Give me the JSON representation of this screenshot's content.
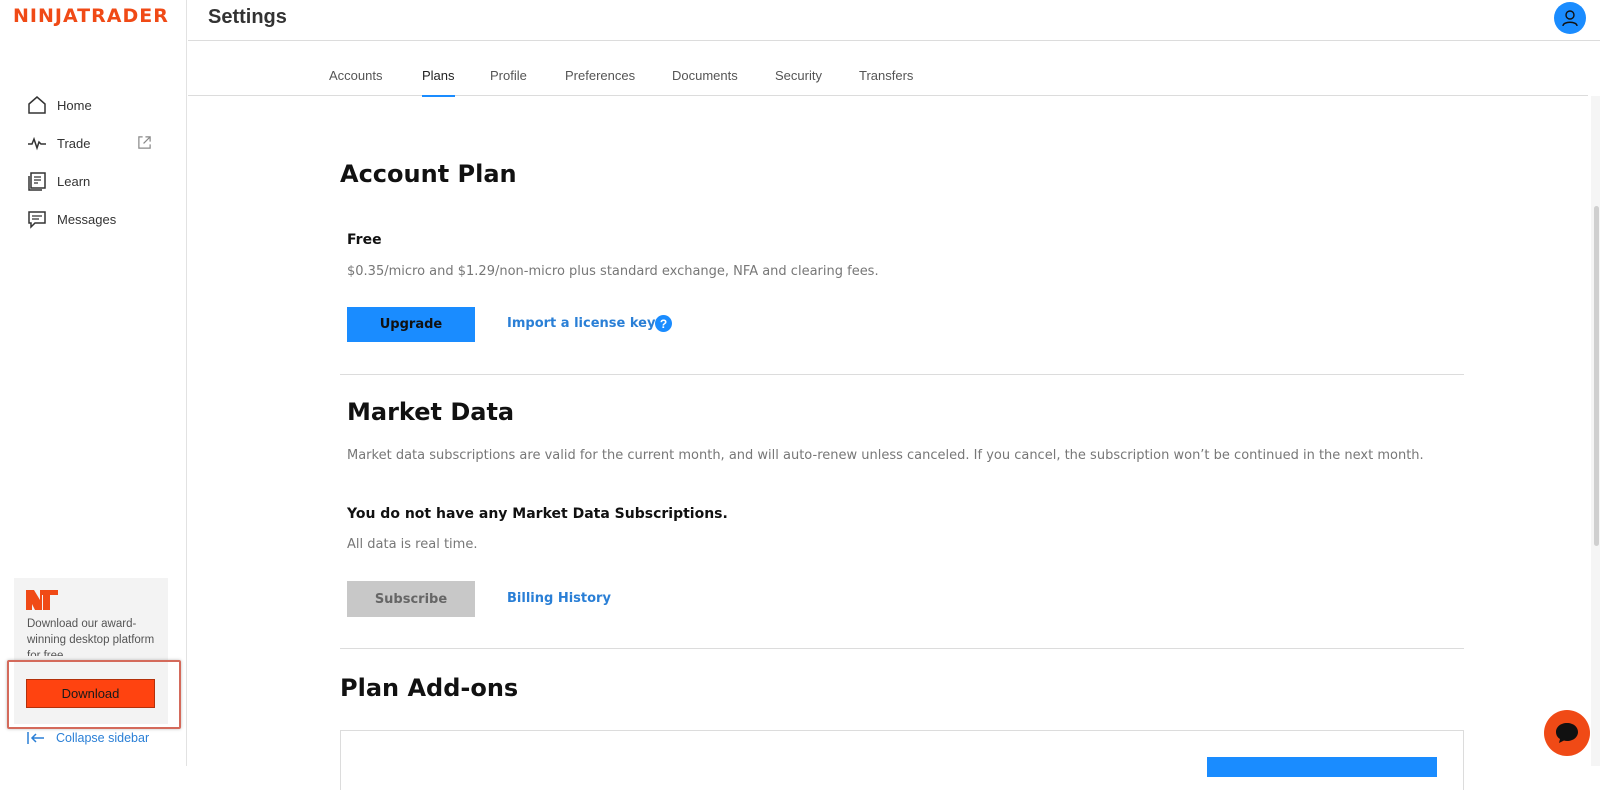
{
  "app": {
    "logo_text": "NINJATRADER",
    "page_title": "Settings",
    "brand_color": "#f04a16",
    "accent_color": "#1a8cff"
  },
  "sidebar": {
    "items": [
      {
        "label": "Home",
        "icon": "home-icon"
      },
      {
        "label": "Trade",
        "icon": "pulse-icon",
        "external": true
      },
      {
        "label": "Learn",
        "icon": "book-icon"
      },
      {
        "label": "Messages",
        "icon": "chat-bubble-icon"
      }
    ],
    "promo_text": "Download our award-winning desktop platform for free.",
    "download_label": "Download",
    "collapse_label": "Collapse sidebar"
  },
  "tabs": [
    {
      "label": "Accounts",
      "active": false
    },
    {
      "label": "Plans",
      "active": true
    },
    {
      "label": "Profile",
      "active": false
    },
    {
      "label": "Preferences",
      "active": false
    },
    {
      "label": "Documents",
      "active": false
    },
    {
      "label": "Security",
      "active": false
    },
    {
      "label": "Transfers",
      "active": false
    }
  ],
  "account_plan": {
    "heading": "Account Plan",
    "plan_name": "Free",
    "plan_description": "$0.35/micro and $1.29/non-micro plus standard exchange, NFA and clearing fees.",
    "upgrade_label": "Upgrade",
    "import_label": "Import a license key",
    "help_glyph": "?"
  },
  "market_data": {
    "heading": "Market Data",
    "description": "Market data subscriptions are valid for the current month, and will auto-renew unless canceled. If you cancel, the subscription won’t be continued in the next month.",
    "no_subscriptions": "You do not have any Market Data Subscriptions.",
    "realtime_note": "All data is real time.",
    "subscribe_label": "Subscribe",
    "billing_history_label": "Billing History"
  },
  "plan_addons": {
    "heading": "Plan Add-ons"
  }
}
